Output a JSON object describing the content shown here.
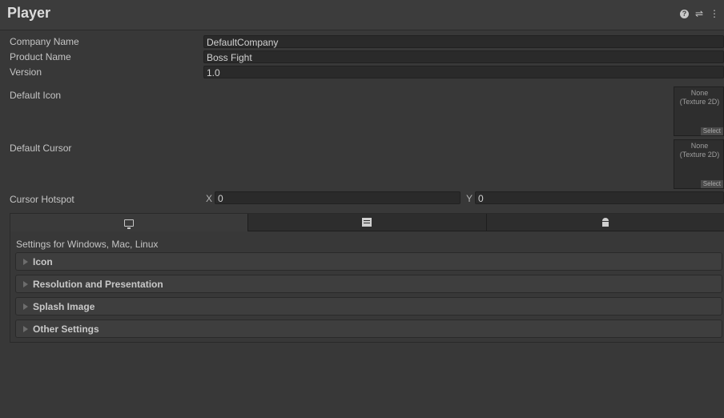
{
  "header": {
    "title": "Player"
  },
  "fields": {
    "company_label": "Company Name",
    "company_value": "DefaultCompany",
    "product_label": "Product Name",
    "product_value": "Boss Fight",
    "version_label": "Version",
    "version_value": "1.0",
    "icon_label": "Default Icon",
    "cursor_label": "Default Cursor",
    "hotspot_label": "Cursor Hotspot",
    "hotspot_x_label": "X",
    "hotspot_x_value": "0",
    "hotspot_y_label": "Y",
    "hotspot_y_value": "0"
  },
  "object_slot": {
    "none_text": "None",
    "type_text": "(Texture 2D)",
    "select_label": "Select"
  },
  "platform": {
    "tabs": [
      {
        "icon": "monitor-icon",
        "active": true
      },
      {
        "icon": "webgl-icon",
        "active": false
      },
      {
        "icon": "android-icon",
        "active": false
      }
    ],
    "settings_label": "Settings for Windows, Mac, Linux",
    "sections": [
      {
        "label": "Icon"
      },
      {
        "label": "Resolution and Presentation"
      },
      {
        "label": "Splash Image"
      },
      {
        "label": "Other Settings"
      }
    ]
  }
}
